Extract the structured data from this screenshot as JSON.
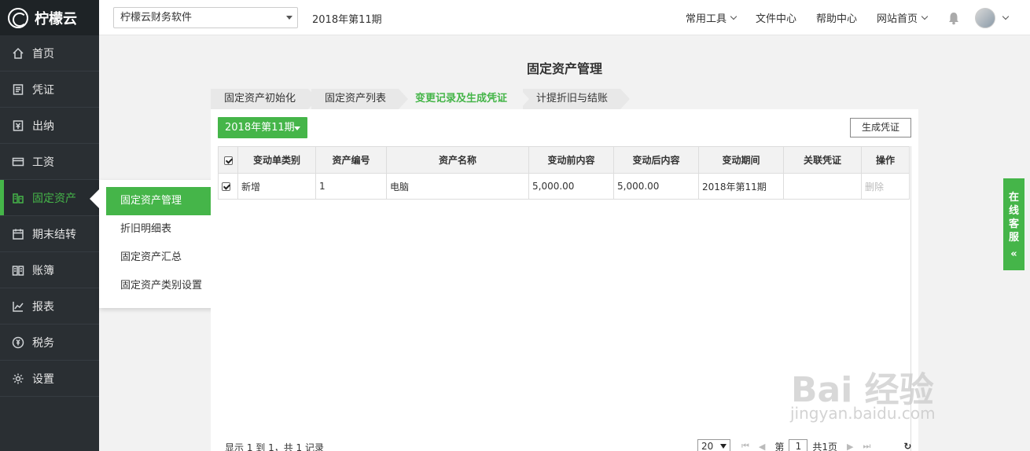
{
  "app": {
    "logo_text": "柠檬云"
  },
  "sidebar": {
    "items": [
      {
        "label": "首页",
        "icon": "home-icon"
      },
      {
        "label": "凭证",
        "icon": "voucher-icon"
      },
      {
        "label": "出纳",
        "icon": "cashier-icon"
      },
      {
        "label": "工资",
        "icon": "salary-icon"
      },
      {
        "label": "固定资产",
        "icon": "fixed-asset-icon"
      },
      {
        "label": "期末结转",
        "icon": "period-close-icon"
      },
      {
        "label": "账簿",
        "icon": "ledger-icon"
      },
      {
        "label": "报表",
        "icon": "report-icon"
      },
      {
        "label": "税务",
        "icon": "tax-icon"
      },
      {
        "label": "设置",
        "icon": "settings-icon"
      }
    ],
    "active_index": 4
  },
  "flyout": {
    "items": [
      "固定资产管理",
      "折旧明细表",
      "固定资产汇总",
      "固定资产类别设置"
    ],
    "active_index": 0
  },
  "topbar": {
    "company": "柠檬云财务软件",
    "period": "2018年第11期",
    "links": [
      "常用工具",
      "文件中心",
      "帮助中心",
      "网站首页"
    ]
  },
  "main": {
    "title": "固定资产管理",
    "tabs": [
      "固定资产初始化",
      "固定资产列表",
      "变更记录及生成凭证",
      "计提折旧与结账"
    ],
    "active_tab": 2,
    "period_button": "2018年第11期",
    "generate_button": "生成凭证",
    "table": {
      "headers": [
        "变动单类别",
        "资产编号",
        "资产名称",
        "变动前内容",
        "变动后内容",
        "变动期间",
        "关联凭证",
        "操作"
      ],
      "rows": [
        {
          "type": "新增",
          "code": "1",
          "name": "电脑",
          "before": "5,000.00",
          "after": "5,000.00",
          "period": "2018年第11期",
          "voucher": "",
          "op": "删除",
          "checked": true
        }
      ]
    },
    "footer": {
      "summary": "显示 1 到 1，共 1 记录",
      "page_size": "20",
      "page_prefix": "第",
      "page": "1",
      "page_total": "共1页"
    }
  },
  "service": {
    "label": "在线客服"
  },
  "watermark": {
    "logo": "Bai 经验",
    "url": "jingyan.baidu.com"
  },
  "colors": {
    "accent": "#45b549",
    "sidebar": "#2a2f33"
  }
}
